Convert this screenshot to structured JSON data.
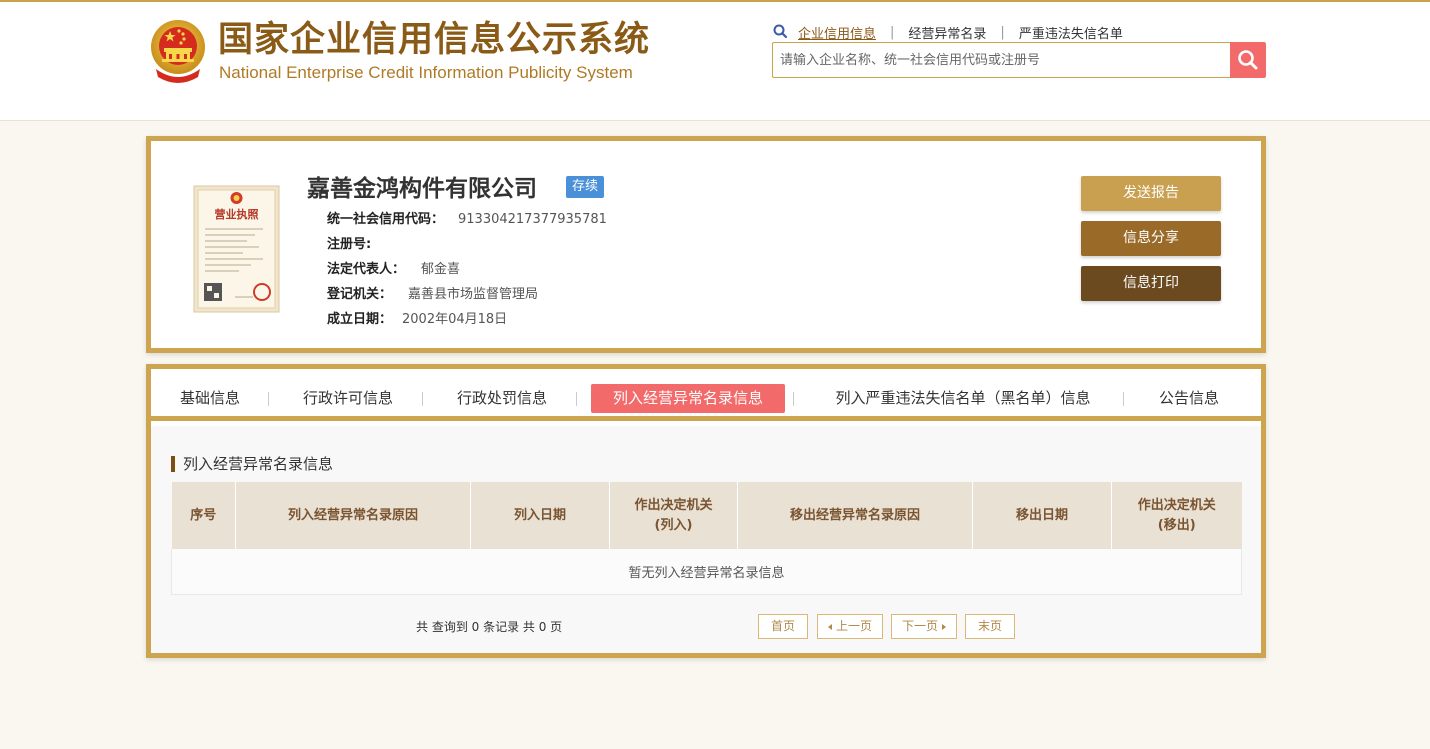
{
  "header": {
    "title_cn": "国家企业信用信息公示系统",
    "title_en": "National Enterprise Credit Information Publicity System",
    "links": [
      {
        "label": "企业信用信息"
      },
      {
        "label": "经营异常名录"
      },
      {
        "label": "严重违法失信名单"
      }
    ],
    "link_separator": "|",
    "search_placeholder": "请输入企业名称、统一社会信用代码或注册号"
  },
  "company": {
    "name": "嘉善金鸿构件有限公司",
    "status": "存续",
    "fields": [
      {
        "label": "统一社会信用代码：",
        "value": "913304217377935781"
      },
      {
        "label": "注册号:",
        "value": ""
      },
      {
        "label": "法定代表人：",
        "value": "郁金喜"
      },
      {
        "label": "登记机关：",
        "value": "嘉善县市场监督管理局"
      },
      {
        "label": "成立日期：",
        "value": "2002年04月18日"
      }
    ],
    "license_image_title": "营业执照"
  },
  "actions": {
    "send_report": "发送报告",
    "share": "信息分享",
    "print": "信息打印"
  },
  "tabs": [
    {
      "label": "基础信息"
    },
    {
      "label": "行政许可信息"
    },
    {
      "label": "行政处罚信息"
    },
    {
      "label": "列入经营异常名录信息"
    },
    {
      "label": "列入严重违法失信名单（黑名单）信息"
    },
    {
      "label": "公告信息"
    }
  ],
  "section": {
    "title": "列入经营异常名录信息",
    "columns": [
      {
        "line1": "序号",
        "line2": ""
      },
      {
        "line1": "列入经营异常名录原因",
        "line2": ""
      },
      {
        "line1": "列入日期",
        "line2": ""
      },
      {
        "line1": "作出决定机关",
        "line2": "(列入)"
      },
      {
        "line1": "移出经营异常名录原因",
        "line2": ""
      },
      {
        "line1": "移出日期",
        "line2": ""
      },
      {
        "line1": "作出决定机关",
        "line2": "(移出)"
      }
    ],
    "empty_message": "暂无列入经营异常名录信息",
    "summary": "共 查询到 0 条记录 共 0 页"
  },
  "pager": {
    "first": "首页",
    "prev": "上一页",
    "next": "下一页",
    "last": "末页"
  },
  "colors": {
    "brand_gold": "#cda44f",
    "brand_brown": "#8a5a17",
    "active_tab": "#f26a6a",
    "status_badge": "#4a90d9",
    "btn_send": "#c9a050",
    "btn_share": "#9a6a28",
    "btn_print": "#6a4a1e"
  },
  "icons": {
    "emblem": "national-emblem-icon",
    "search": "search-icon",
    "license": "business-license-icon"
  }
}
